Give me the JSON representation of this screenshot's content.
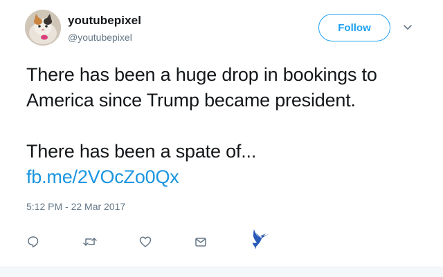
{
  "user": {
    "display_name": "youtubepixel",
    "handle": "@youtubepixel"
  },
  "follow": {
    "label": "Follow"
  },
  "tweet": {
    "paragraph_1": "There has been a huge drop in bookings to America since Trump became president.",
    "paragraph_2": "There has been a spate of...",
    "link": "fb.me/2VOcZo0Qx"
  },
  "timestamp": "5:12 PM - 22 Mar 2017",
  "colors": {
    "accent": "#1da1f2",
    "link": "#1b95e0",
    "muted": "#657786",
    "text": "#14171a"
  },
  "icons": {
    "reply": "speech-bubble-icon",
    "retweet": "retweet-icon",
    "like": "heart-icon",
    "dm": "envelope-icon",
    "extra": "hummingbird-icon"
  }
}
